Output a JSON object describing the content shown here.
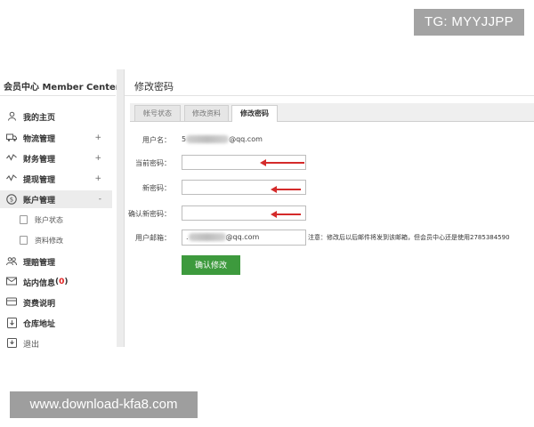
{
  "watermarks": {
    "top": "TG: MYYJJPP",
    "bottom": "www.download-kfa8.com"
  },
  "sidebar": {
    "title": "会员中心 Member Center",
    "items": [
      {
        "label": "我的主页",
        "icon": "user-icon"
      },
      {
        "label": "物流管理",
        "icon": "truck-icon",
        "toggle": "+"
      },
      {
        "label": "财务管理",
        "icon": "chart-line-icon",
        "toggle": "+"
      },
      {
        "label": "提现管理",
        "icon": "chart-line-icon",
        "toggle": "+"
      },
      {
        "label": "账户管理",
        "icon": "account-badge-icon",
        "toggle": "-"
      },
      {
        "label": "理赔管理",
        "icon": "users-icon"
      },
      {
        "label": "站内信息",
        "badge": "0",
        "icon": "mail-icon"
      },
      {
        "label": "资费说明",
        "icon": "card-icon"
      },
      {
        "label": "仓库地址",
        "icon": "location-icon"
      },
      {
        "label": "退出",
        "icon": "exit-icon"
      }
    ],
    "subitems": [
      {
        "label": "账户状态",
        "icon": "clipboard-icon"
      },
      {
        "label": "资料修改",
        "icon": "clipboard-icon"
      }
    ]
  },
  "main": {
    "title": "修改密码",
    "tabs": [
      {
        "label": "帐号状态",
        "active": false
      },
      {
        "label": "修改资料",
        "active": false
      },
      {
        "label": "修改密码",
        "active": true
      }
    ],
    "form": {
      "username_label": "用户名：",
      "username_prefix": "5",
      "username_suffix": "@qq.com",
      "current_password_label": "当前密码：",
      "new_password_label": "新密码：",
      "confirm_password_label": "确认新密码：",
      "email_label": "用户邮箱：",
      "email_prefix": ".",
      "email_suffix": "@qq.com",
      "note": "注意：修改后以后邮件将发到该邮箱，但会员中心还是使用2785384590",
      "submit_label": "确认修改"
    }
  },
  "colors": {
    "submit_bg": "#3d9a3d",
    "arrow": "#d42a2a",
    "badge_number": "#e02020"
  }
}
